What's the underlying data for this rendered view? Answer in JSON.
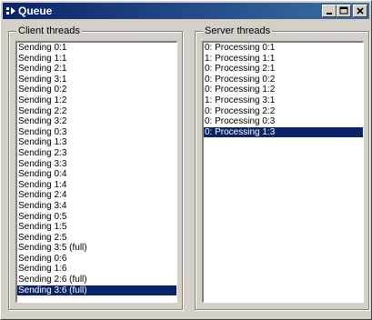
{
  "window": {
    "title": "Queue",
    "colors": {
      "titlebar_start": "#0a246a",
      "titlebar_end": "#3a6ea5",
      "face": "#d4d0c8",
      "selection": "#0a246a"
    },
    "icons": {
      "app": "app-icon",
      "minimize": "minimize-icon",
      "maximize": "maximize-icon",
      "close": "close-icon"
    }
  },
  "client": {
    "label": "Client threads",
    "items": [
      "Sending 0:1",
      "Sending 1:1",
      "Sending 2:1",
      "Sending 3:1",
      "Sending 0:2",
      "Sending 1:2",
      "Sending 2:2",
      "Sending 3:2",
      "Sending 0:3",
      "Sending 1:3",
      "Sending 2:3",
      "Sending 3:3",
      "Sending 0:4",
      "Sending 1:4",
      "Sending 2:4",
      "Sending 3:4",
      "Sending 0:5",
      "Sending 1:5",
      "Sending 2:5",
      "Sending 3:5 (full)",
      "Sending 0:6",
      "Sending 1:6",
      "Sending 2:6 (full)",
      "Sending 3:6 (full)"
    ],
    "selected_index": 23
  },
  "server": {
    "label": "Server threads",
    "items": [
      "0: Processing 0:1",
      "1: Processing 1:1",
      "0: Processing 2:1",
      "0: Processing 0:2",
      "0: Processing 1:2",
      "1: Processing 3:1",
      "0: Processing 2:2",
      "0: Processing 0:3",
      "0: Processing 1:3"
    ],
    "selected_index": 8
  }
}
